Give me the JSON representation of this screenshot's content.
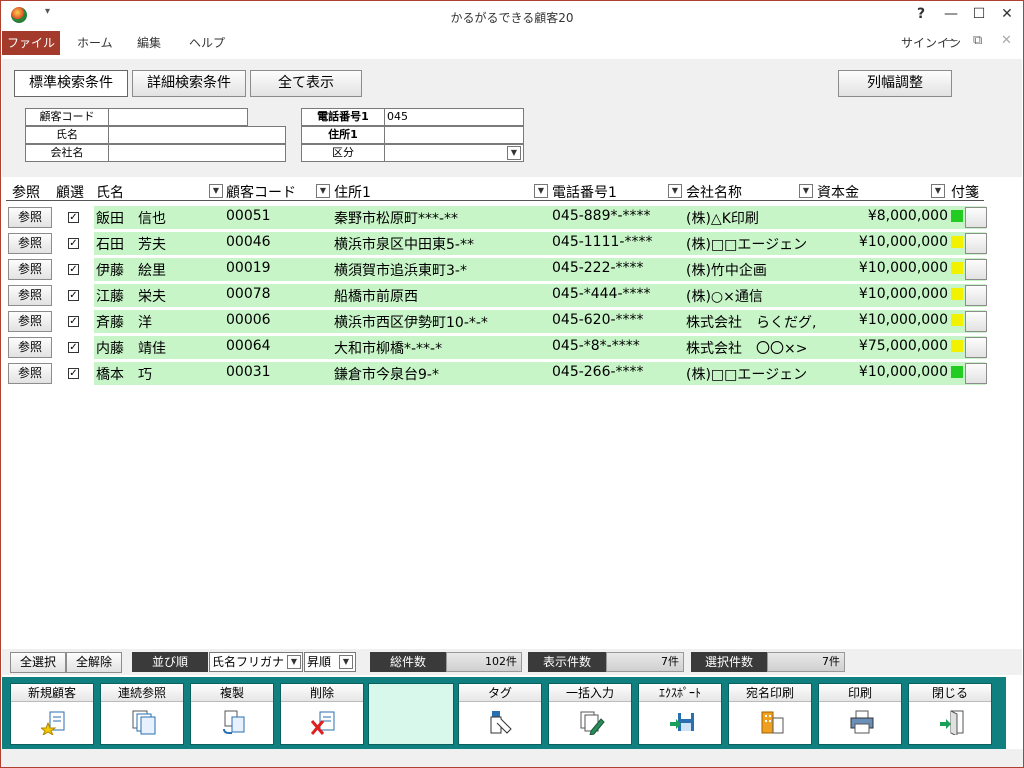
{
  "window": {
    "title": "かるがるできる顧客20",
    "help": "?",
    "min": "—",
    "max": "☐",
    "close": "✕"
  },
  "ribbon": {
    "tabs": [
      {
        "label": "ファイル"
      },
      {
        "label": "ホーム"
      },
      {
        "label": "編集"
      },
      {
        "label": "ヘルプ"
      }
    ],
    "signin": "サインイン",
    "min": "—",
    "restore": "⧉",
    "close": "✕"
  },
  "search": {
    "standard_tab": "標準検索条件",
    "detail_tab": "詳細検索条件",
    "show_all": "全て表示",
    "column_width": "列幅調整",
    "labels": {
      "customer_code": "顧客コード",
      "name": "氏名",
      "company": "会社名",
      "phone1": "電話番号1",
      "address1": "住所1",
      "category": "区分"
    },
    "values": {
      "customer_code": "",
      "name": "",
      "company": "",
      "phone1": "045",
      "address1": "",
      "category": ""
    }
  },
  "grid": {
    "headers": {
      "ref": "参照",
      "sel": "顧選",
      "name": "氏名",
      "code": "顧客コード",
      "address": "住所1",
      "phone": "電話番号1",
      "company": "会社名称",
      "capital": "資本金",
      "tag": "付箋"
    },
    "ref_label": "参照",
    "rows": [
      {
        "name": "飯田　信也",
        "code": "00051",
        "address": "秦野市松原町***-**",
        "phone": "045-889*-****",
        "company": "(株)△K印刷",
        "capital": "¥8,000,000",
        "tag_color": "#22cc22"
      },
      {
        "name": "石田　芳夫",
        "code": "00046",
        "address": "横浜市泉区中田東5-**",
        "phone": "045-1111-****",
        "company": "(株)□□エージェン",
        "capital": "¥10,000,000",
        "tag_color": "#f2f200"
      },
      {
        "name": "伊藤　絵里",
        "code": "00019",
        "address": "横須賀市追浜東町3-*",
        "phone": "045-222-****",
        "company": "(株)竹中企画",
        "capital": "¥10,000,000",
        "tag_color": "#f2f200"
      },
      {
        "name": "江藤　栄夫",
        "code": "00078",
        "address": "船橋市前原西",
        "phone": "045-*444-****",
        "company": "(株)○×通信",
        "capital": "¥10,000,000",
        "tag_color": "#f2f200"
      },
      {
        "name": "斉藤　洋",
        "code": "00006",
        "address": "横浜市西区伊勢町10-*-*",
        "phone": "045-620-****",
        "company": "株式会社　らくだグ,",
        "capital": "¥10,000,000",
        "tag_color": "#f2f200"
      },
      {
        "name": "内藤　靖佳",
        "code": "00064",
        "address": "大和市柳橋*-**-*",
        "phone": "045-*8*-****",
        "company": "株式会社　〇〇×>",
        "capital": "¥75,000,000",
        "tag_color": "#f2f200"
      },
      {
        "name": "橋本　巧",
        "code": "00031",
        "address": "鎌倉市今泉台9-*",
        "phone": "045-266-****",
        "company": "(株)□□エージェン",
        "capital": "¥10,000,000",
        "tag_color": "#22cc22"
      }
    ]
  },
  "status": {
    "select_all": "全選択",
    "deselect_all": "全解除",
    "sort_label": "並び順",
    "sort_field": "氏名フリガナ",
    "sort_order": "昇順",
    "total_label": "総件数",
    "total_value": "102件",
    "shown_label": "表示件数",
    "shown_value": "7件",
    "selected_label": "選択件数",
    "selected_value": "7件"
  },
  "toolbar": {
    "new_customer": "新規顧客",
    "continuous_ref": "連続参照",
    "duplicate": "複製",
    "delete": "削除",
    "tag": "タグ",
    "bulk_input": "一括入力",
    "export": "ｴｸｽﾎﾟｰﾄ",
    "address_print": "宛名印刷",
    "print": "印刷",
    "close": "閉じる"
  }
}
